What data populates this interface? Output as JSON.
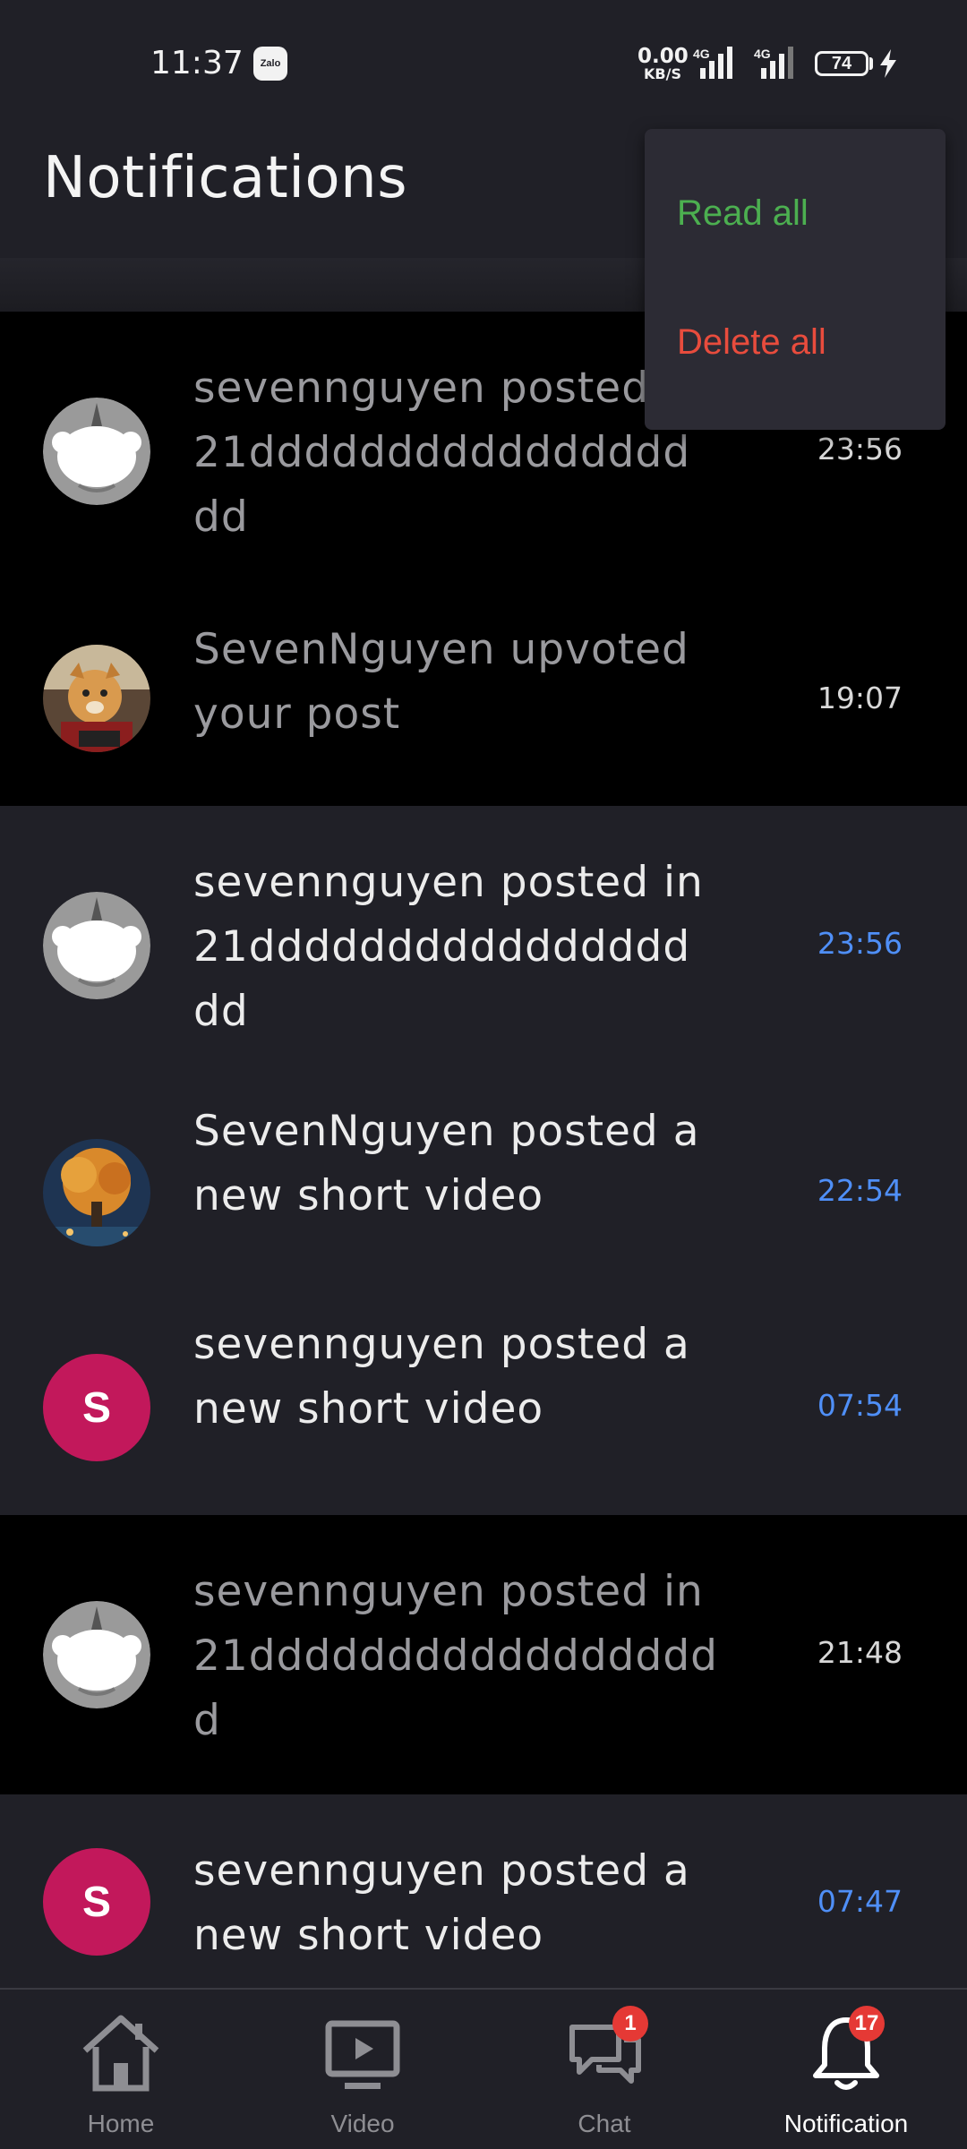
{
  "status_bar": {
    "time": "11:37",
    "zalo_label": "Zalo",
    "net_speed_value": "0.00",
    "net_speed_unit": "KB/S",
    "signal1_label": "4G",
    "signal2_label": "4G",
    "battery_level": "74"
  },
  "header": {
    "title": "Notifications"
  },
  "menu": {
    "read_all": "Read all",
    "delete_all": "Delete all"
  },
  "notifications": [
    {
      "text": "sevennguyen posted in\n21dddddddddddddddd\ndd",
      "time": "23:56",
      "state": "read",
      "avatar": "reddit-snoo"
    },
    {
      "text": "SevenNguyen upvoted\nyour post",
      "time": "19:07",
      "state": "read",
      "avatar": "dog-photo"
    },
    {
      "text": "sevennguyen posted in\n21dddddddddddddddd\ndd",
      "time": "23:56",
      "state": "unread",
      "avatar": "reddit-snoo"
    },
    {
      "text": "SevenNguyen posted a\nnew short video",
      "time": "22:54",
      "state": "unread",
      "avatar": "tree-photo"
    },
    {
      "text": "sevennguyen posted a\nnew short video",
      "time": "07:54",
      "state": "unread",
      "avatar": "S"
    },
    {
      "text": "sevennguyen posted in\n21ddddddddddddddddd\nd",
      "time": "21:48",
      "state": "read",
      "avatar": "reddit-snoo"
    },
    {
      "text": "sevennguyen posted a\nnew short video",
      "time": "07:47",
      "state": "unread",
      "avatar": "S"
    }
  ],
  "bottom_nav": {
    "home": "Home",
    "video": "Video",
    "chat": "Chat",
    "chat_badge": "1",
    "notification": "Notification",
    "notification_badge": "17"
  },
  "colors": {
    "background": "#202027",
    "read_background": "#000000",
    "unread_time": "#4f8ff7",
    "read_all": "#4caf50",
    "delete_all": "#e84c3d",
    "avatar_letter_bg": "#c2185b",
    "badge": "#e53935"
  }
}
